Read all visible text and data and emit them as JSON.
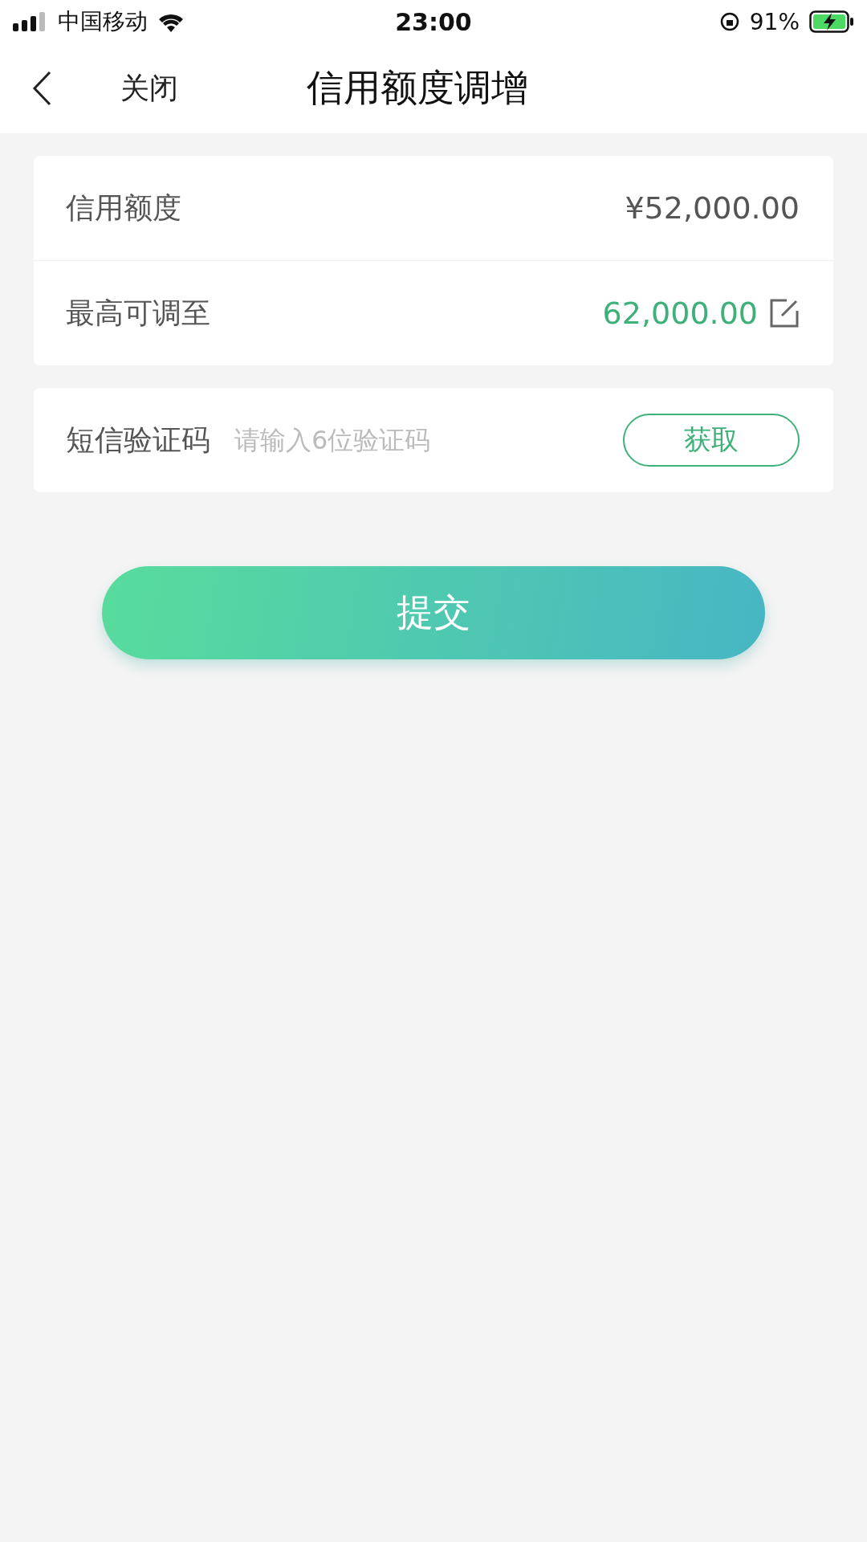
{
  "status_bar": {
    "carrier": "中国移动",
    "time": "23:00",
    "battery": "91%"
  },
  "nav": {
    "close": "关闭",
    "title": "信用额度调增"
  },
  "limit_rows": [
    {
      "label": "信用额度",
      "value": "¥52,000.00",
      "kind": "plain"
    },
    {
      "label": "最高可调至",
      "value": "62,000.00",
      "kind": "editable"
    }
  ],
  "sms": {
    "label": "短信验证码",
    "placeholder": "请输入6位验证码",
    "button": "获取"
  },
  "submit": "提交"
}
